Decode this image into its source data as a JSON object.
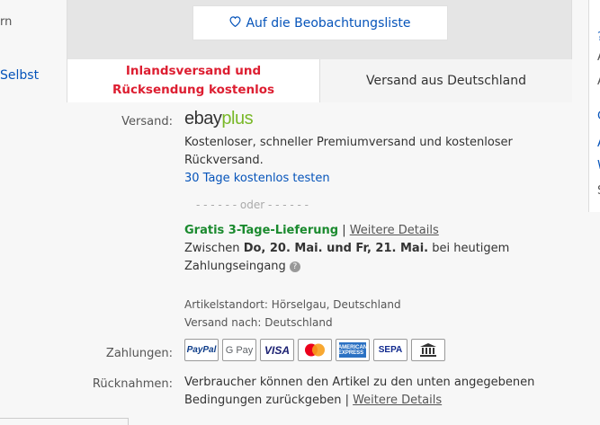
{
  "left": {
    "fragment": "rn",
    "link": "Selbst"
  },
  "right_fragments": [
    "?",
    "A",
    "A",
    "C",
    "A",
    "W",
    "S"
  ],
  "watchlist": {
    "icon": "heart-icon",
    "label": "Auf die Beobachtungsliste"
  },
  "tabs": [
    {
      "label": "Inlandsversand und Rücksendung kostenlos"
    },
    {
      "label": "Versand aus Deutschland"
    }
  ],
  "shipping": {
    "label": "Versand:",
    "ebay_text": "ebay",
    "plus_text": "plus",
    "desc_line1": "Kostenloser, schneller Premiumversand und kostenloser",
    "desc_line2": "Rückversand.",
    "trial_link": "30 Tage kostenlos testen",
    "or_divider": "- - - - - -  oder  - - - - - -",
    "free_delivery": "Gratis 3-Tage-Lieferung",
    "separator": " | ",
    "more_details": "Weitere Details",
    "between": "Zwischen ",
    "date_from": "Do, 20. Mai.",
    "and": " und ",
    "date_to": "Fr, 21. Mai.",
    "payment_suffix": " bei heutigem",
    "payment_line2": "Zahlungseingang",
    "help_icon": "?",
    "location": "Artikelstandort: Hörselgau, Deutschland",
    "ship_to": "Versand nach: Deutschland"
  },
  "payments": {
    "label": "Zahlungen:",
    "methods": [
      "PayPal",
      "G Pay",
      "VISA",
      "Mastercard",
      "AMERICAN EXPRESS",
      "SEPA",
      "Bank"
    ]
  },
  "returns": {
    "label": "Rücknahmen:",
    "line1": "Verbraucher können den Artikel zu den unten angegebenen",
    "line2": "Bedingungen zurückgeben",
    "separator": " | ",
    "more_details": "Weitere Details"
  }
}
